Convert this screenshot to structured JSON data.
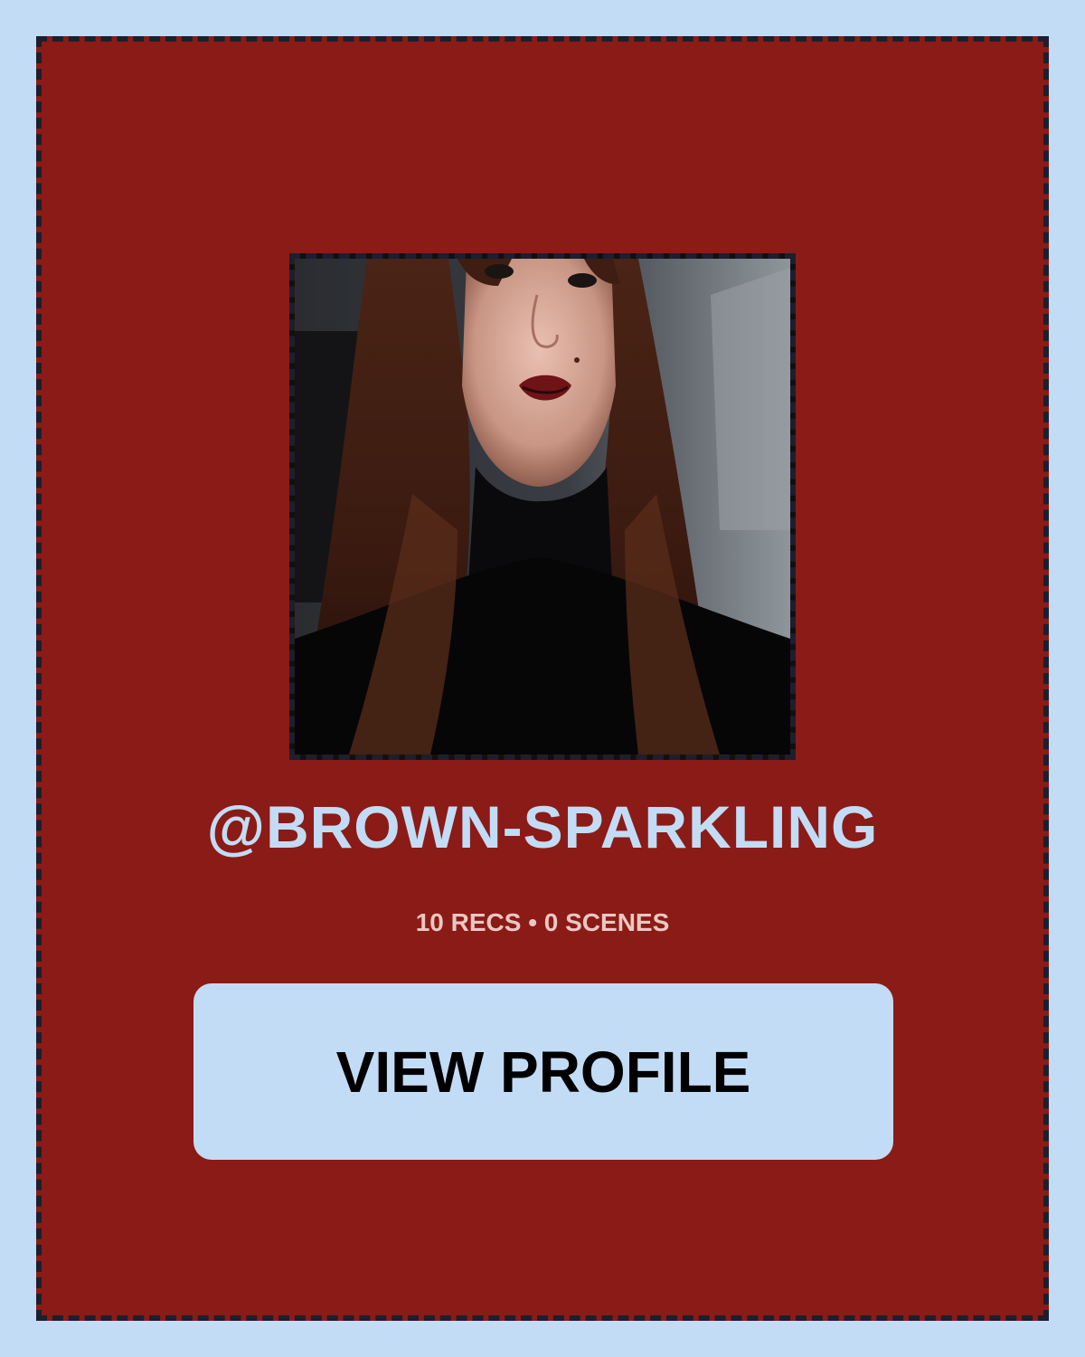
{
  "profile": {
    "username": "@BROWN-SPARKLING",
    "stats": "10 RECS • 0 SCENES",
    "view_button_label": "VIEW PROFILE",
    "photo_alt": "profile photo"
  },
  "colors": {
    "page_background": "#c2dcf6",
    "card_background": "#8b1b16",
    "dashed_border": "#1d1f2e",
    "username_text": "#c2dcf6",
    "stats_text": "#ecc7c2",
    "button_background": "#c2dcf6",
    "button_text": "#000000"
  }
}
